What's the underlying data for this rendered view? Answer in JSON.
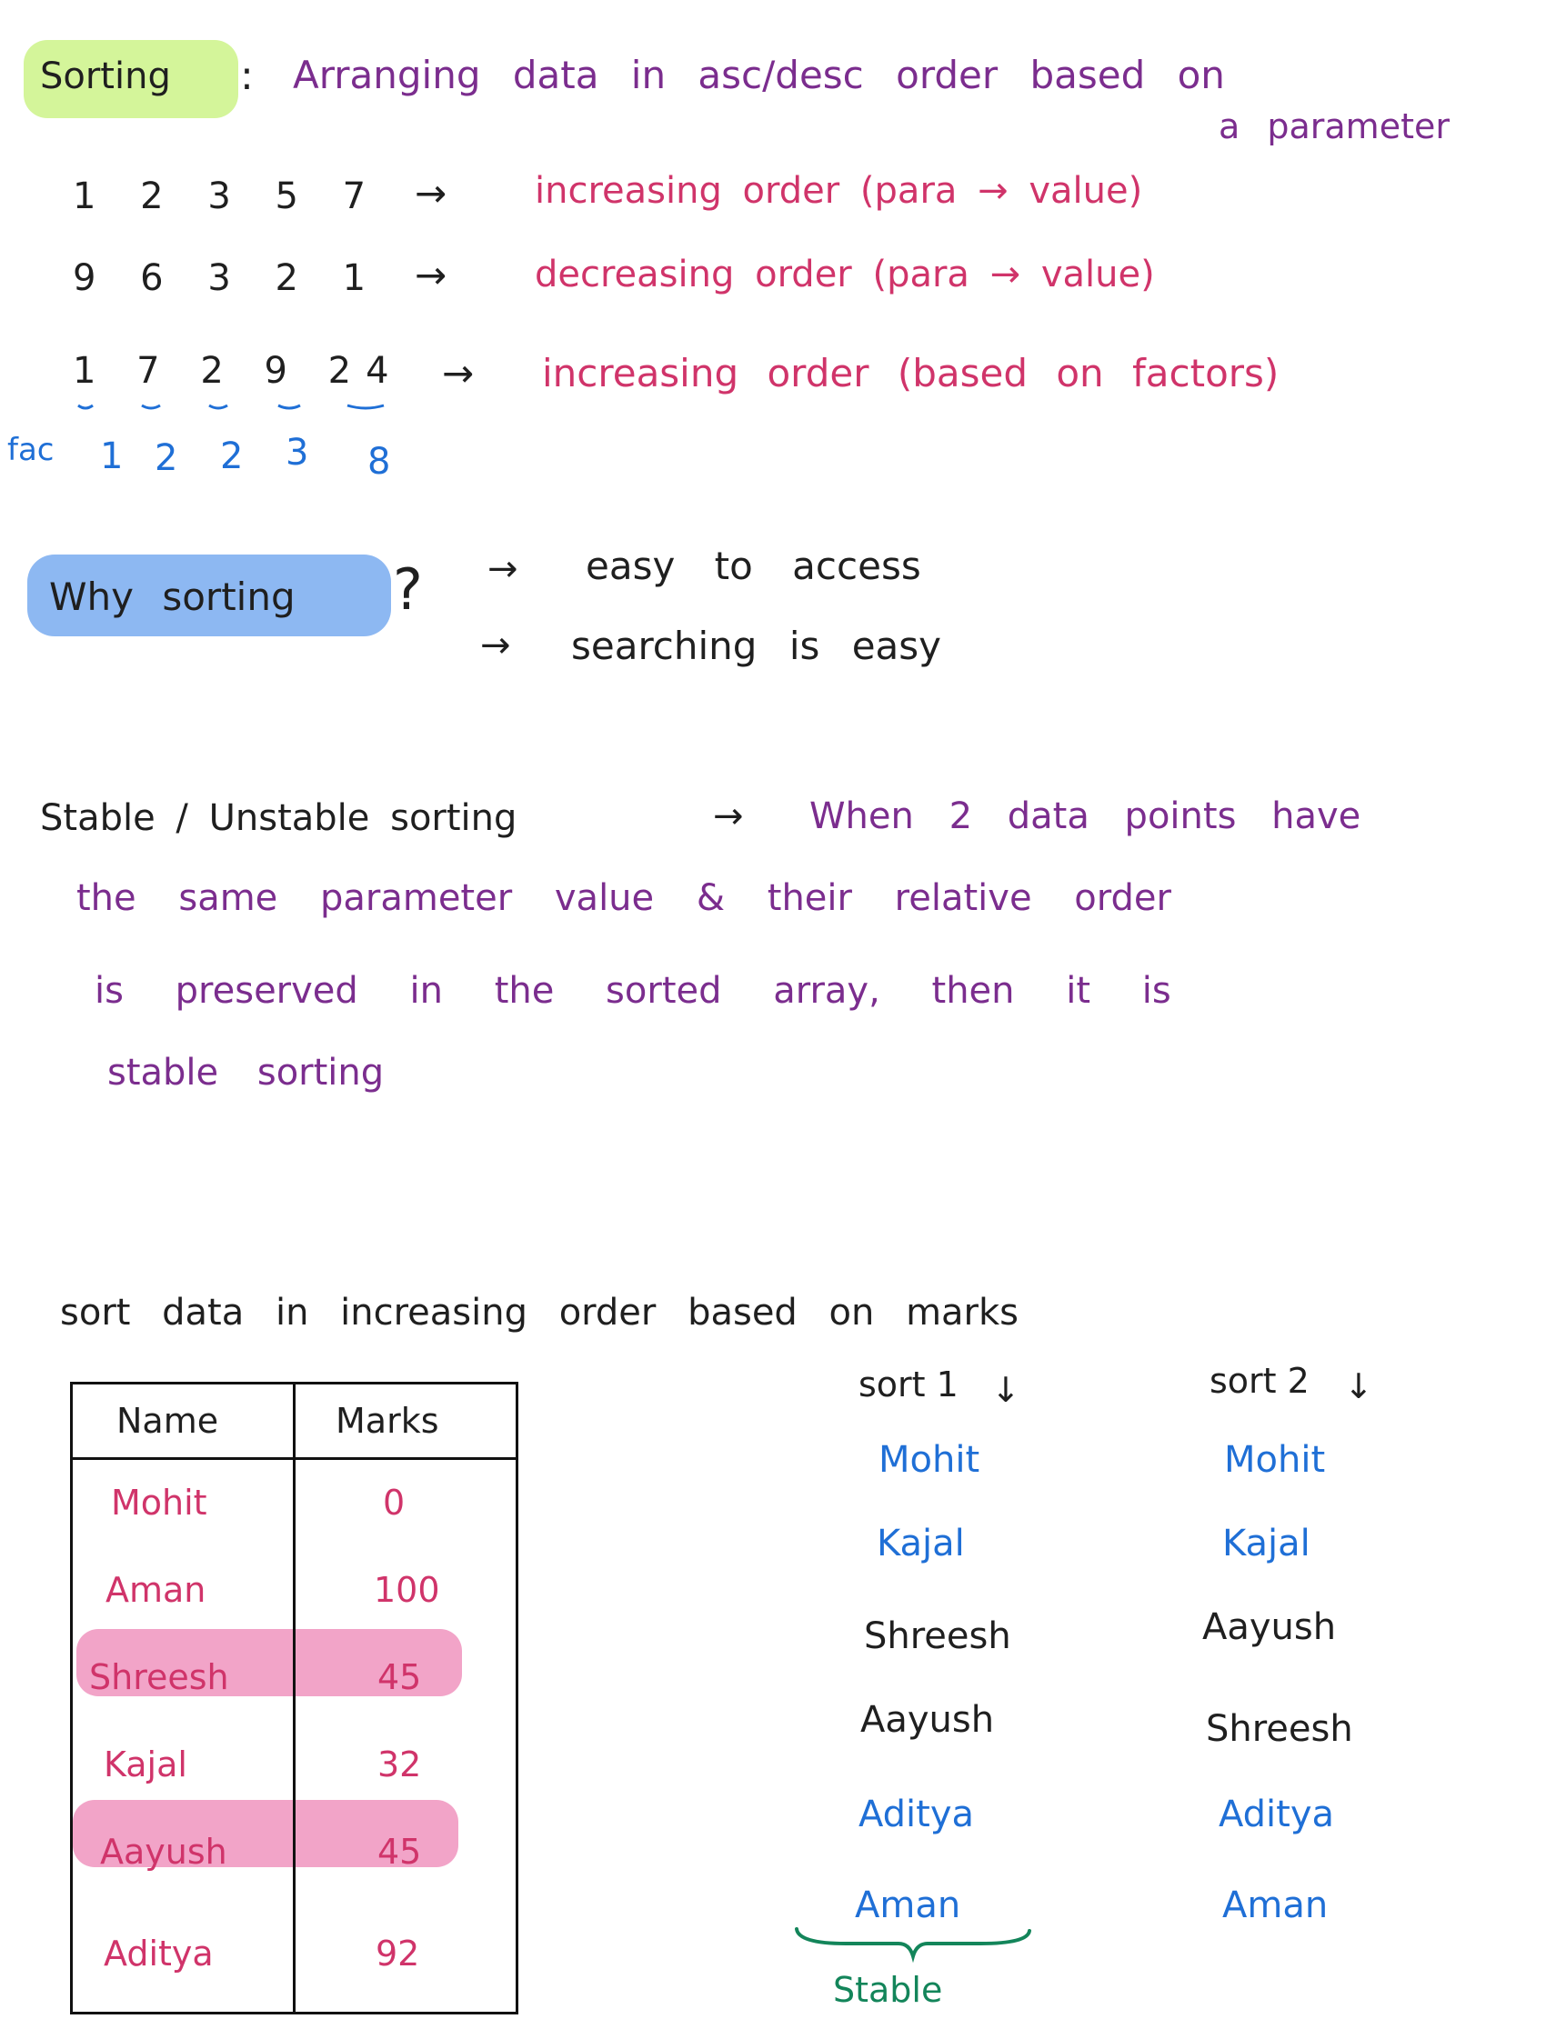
{
  "definition": {
    "term": "Sorting",
    "colon": ":",
    "text_line1": "Arranging data in asc/desc order based on",
    "text_line2": "a parameter"
  },
  "examples": [
    {
      "sequence": "1 2 3 5 7",
      "arrow": "→",
      "description": "increasing order (para → value)"
    },
    {
      "sequence": "9 6 3 2 1",
      "arrow": "→",
      "description": "decreasing order (para → value)"
    },
    {
      "sequence": "1 7 2 9 24",
      "arrow": "→",
      "description": "increasing order (based on factors)"
    }
  ],
  "factors": {
    "label": "fac",
    "values": [
      "1",
      "2",
      "2",
      "3",
      "8"
    ]
  },
  "why": {
    "heading": "Why sorting",
    "question_mark": "?",
    "reasons": [
      "easy to access",
      "searching is easy"
    ],
    "bullet": "→"
  },
  "stable": {
    "heading": "Stable / Unstable sorting",
    "arrow": "→",
    "line1": "When 2 data points have",
    "line2": "the same parameter value & their relative order",
    "line3": "is preserved in the sorted array, then it is",
    "line4": "stable sorting"
  },
  "task": "sort data in increasing order based on marks",
  "table": {
    "headers": [
      "Name",
      "Marks"
    ],
    "rows": [
      {
        "name": "Mohit",
        "marks": "0"
      },
      {
        "name": "Aman",
        "marks": "100"
      },
      {
        "name": "Shreesh",
        "marks": "45"
      },
      {
        "name": "Kajal",
        "marks": "32"
      },
      {
        "name": "Aayush",
        "marks": "45"
      },
      {
        "name": "Aditya",
        "marks": "92"
      }
    ]
  },
  "sort1": {
    "label": "sort 1",
    "down_arrow": "↓",
    "items": [
      "Mohit",
      "Kajal",
      "Shreesh",
      "Aayush",
      "Aditya",
      "Aman"
    ],
    "brace_label": "Stable"
  },
  "sort2": {
    "label": "sort 2",
    "down_arrow": "↓",
    "items": [
      "Mohit",
      "Kajal",
      "Aayush",
      "Shreesh",
      "Aditya",
      "Aman"
    ]
  },
  "colors": {
    "green_highlight": "#d4f59a",
    "blue_highlight": "#8db8f2",
    "pink_highlight": "#f2a4c8",
    "magenta_ink": "#d0346a",
    "purple_ink": "#7b2d8e",
    "blue_ink": "#1f6fd6",
    "green_ink": "#13855a"
  }
}
